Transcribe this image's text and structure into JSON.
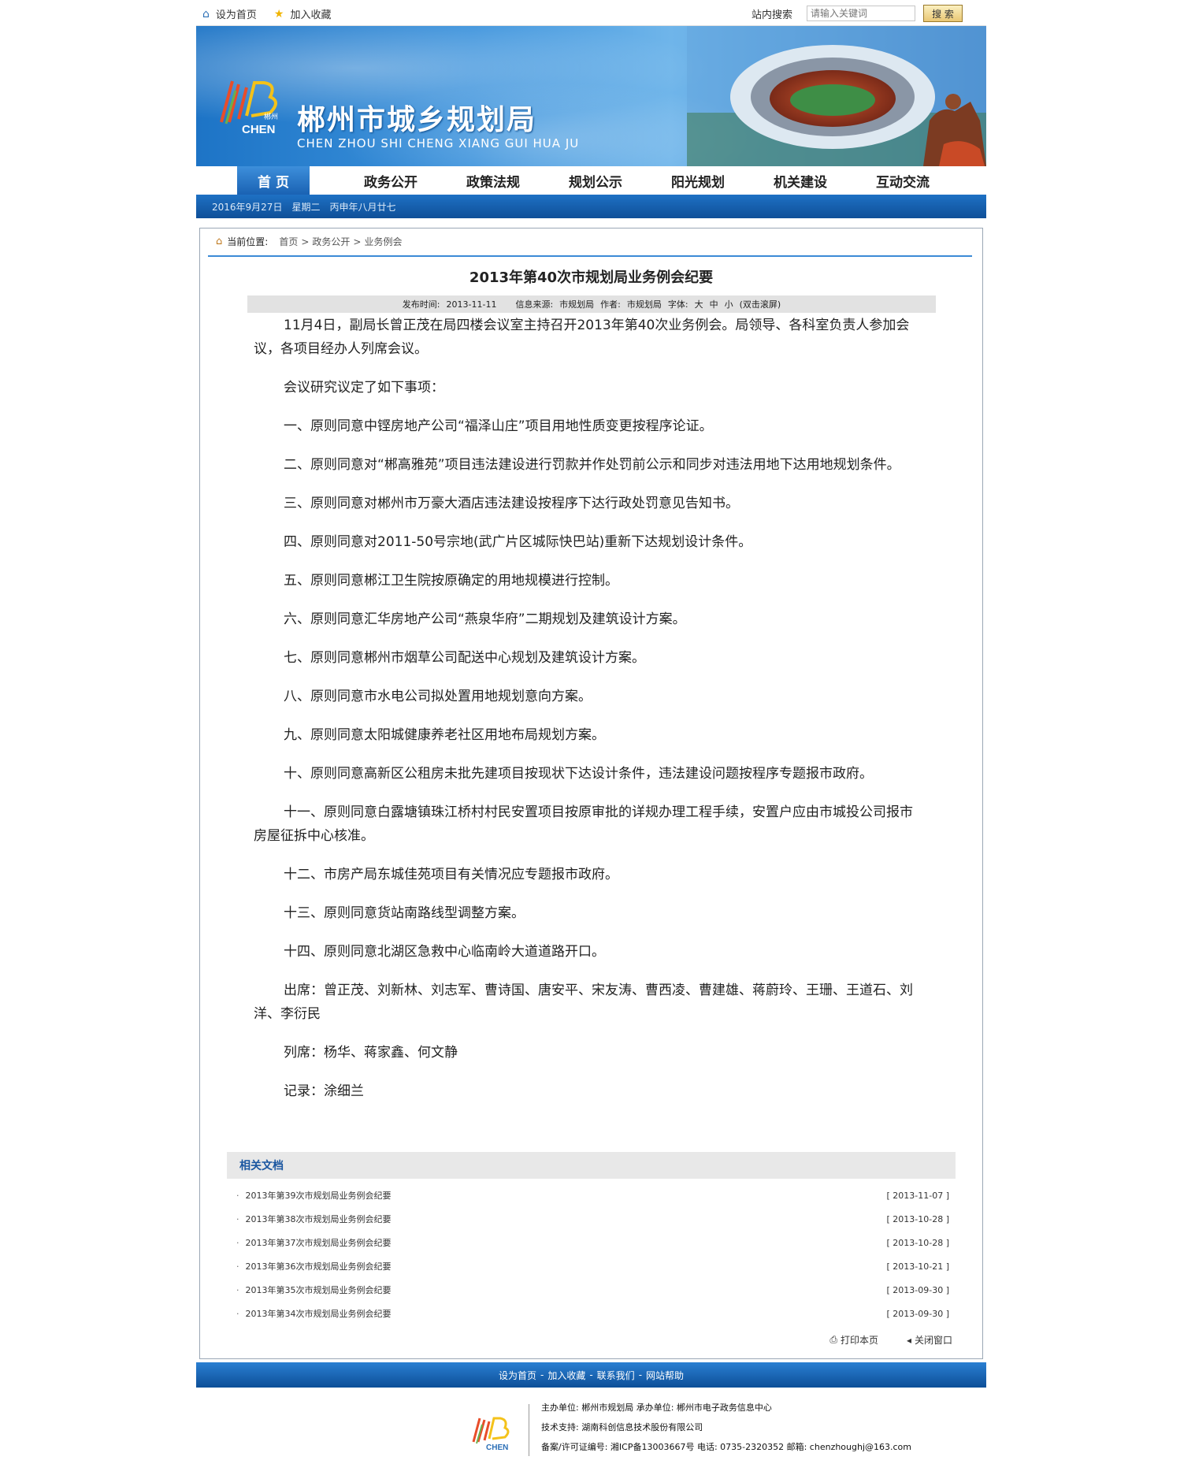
{
  "topbar": {
    "set_home": "设为首页",
    "add_fav": "加入收藏",
    "search_label": "站内搜索",
    "search_placeholder": "请输入关键词",
    "search_button": "搜 索"
  },
  "banner": {
    "title": "郴州市城乡规划局",
    "subtitle": "CHEN ZHOU SHI CHENG XIANG GUI HUA JU",
    "logo_text_cn": "郴州",
    "logo_text_en": "CHEN"
  },
  "nav": {
    "items": [
      {
        "label": "首 页",
        "active": true
      },
      {
        "label": "政务公开"
      },
      {
        "label": "政策法规"
      },
      {
        "label": "规划公示"
      },
      {
        "label": "阳光规划"
      },
      {
        "label": "机关建设"
      },
      {
        "label": "互动交流"
      }
    ]
  },
  "datebar": {
    "date": "2016年9月27日　星期二　丙申年八月廿七"
  },
  "breadcrumb": {
    "label": "当前位置:",
    "items": [
      "首页",
      "政务公开",
      "业务例会"
    ]
  },
  "article": {
    "title": "2013年第40次市规划局业务例会纪要",
    "meta": {
      "publish_label": "发布时间:",
      "publish_date": "2013-11-11",
      "source_label": "信息来源:",
      "source": "市规划局",
      "author_label": "作者:",
      "author": "市规划局",
      "font_label": "字体:",
      "font_large": "大",
      "font_medium": "中",
      "font_small": "小",
      "scroll": "(双击滚屏)"
    },
    "paragraphs": [
      "11月4日，副局长曾正茂在局四楼会议室主持召开2013年第40次业务例会。局领导、各科室负责人参加会议，各项目经办人列席会议。",
      "会议研究议定了如下事项：",
      "一、原则同意中铿房地产公司“福泽山庄”项目用地性质变更按程序论证。",
      "二、原则同意对“郴高雅苑”项目违法建设进行罚款并作处罚前公示和同步对违法用地下达用地规划条件。",
      "三、原则同意对郴州市万豪大酒店违法建设按程序下达行政处罚意见告知书。",
      "四、原则同意对2011-50号宗地(武广片区城际快巴站)重新下达规划设计条件。",
      "五、原则同意郴江卫生院按原确定的用地规模进行控制。",
      "六、原则同意汇华房地产公司“燕泉华府”二期规划及建筑设计方案。",
      "七、原则同意郴州市烟草公司配送中心规划及建筑设计方案。",
      "八、原则同意市水电公司拟处置用地规划意向方案。",
      "九、原则同意太阳城健康养老社区用地布局规划方案。",
      "十、原则同意高新区公租房未批先建项目按现状下达设计条件，违法建设问题按程序专题报市政府。",
      "十一、原则同意白露塘镇珠江桥村村民安置项目按原审批的详规办理工程手续，安置户应由市城投公司报市房屋征拆中心核准。",
      "十二、市房产局东城佳苑项目有关情况应专题报市政府。",
      "十三、原则同意货站南路线型调整方案。",
      "十四、原则同意北湖区急救中心临南岭大道道路开口。",
      "出席：曾正茂、刘新林、刘志军、曹诗国、唐安平、宋友涛、曹西凌、曹建雄、蒋蔚玲、王珊、王道石、刘洋、李衍民",
      "列席：杨华、蒋家鑫、何文静",
      "记录：涂细兰"
    ]
  },
  "related": {
    "heading": "相关文档",
    "items": [
      {
        "title": "2013年第39次市规划局业务例会纪要",
        "date": "[ 2013-11-07 ]"
      },
      {
        "title": "2013年第38次市规划局业务例会纪要",
        "date": "[ 2013-10-28 ]"
      },
      {
        "title": "2013年第37次市规划局业务例会纪要",
        "date": "[ 2013-10-28 ]"
      },
      {
        "title": "2013年第36次市规划局业务例会纪要",
        "date": "[ 2013-10-21 ]"
      },
      {
        "title": "2013年第35次市规划局业务例会纪要",
        "date": "[ 2013-09-30 ]"
      },
      {
        "title": "2013年第34次市规划局业务例会纪要",
        "date": "[ 2013-09-30 ]"
      }
    ]
  },
  "tools": {
    "print": "打印本页",
    "close": "关闭窗口"
  },
  "footer": {
    "links": [
      "设为首页",
      "加入收藏",
      "联系我们",
      "网站帮助"
    ],
    "separator": "-",
    "line1": "主办单位: 郴州市规划局  承办单位: 郴州市电子政务信息中心",
    "line2": "技术支持: 湖南科创信息技术股份有限公司",
    "line3": "备案/许可证编号: 湘ICP备13003667号  电话: 0735-2320352  邮箱: chenzhoughj@163.com"
  },
  "colors": {
    "accent": "#1a62b3",
    "link": "#1a56a0"
  }
}
